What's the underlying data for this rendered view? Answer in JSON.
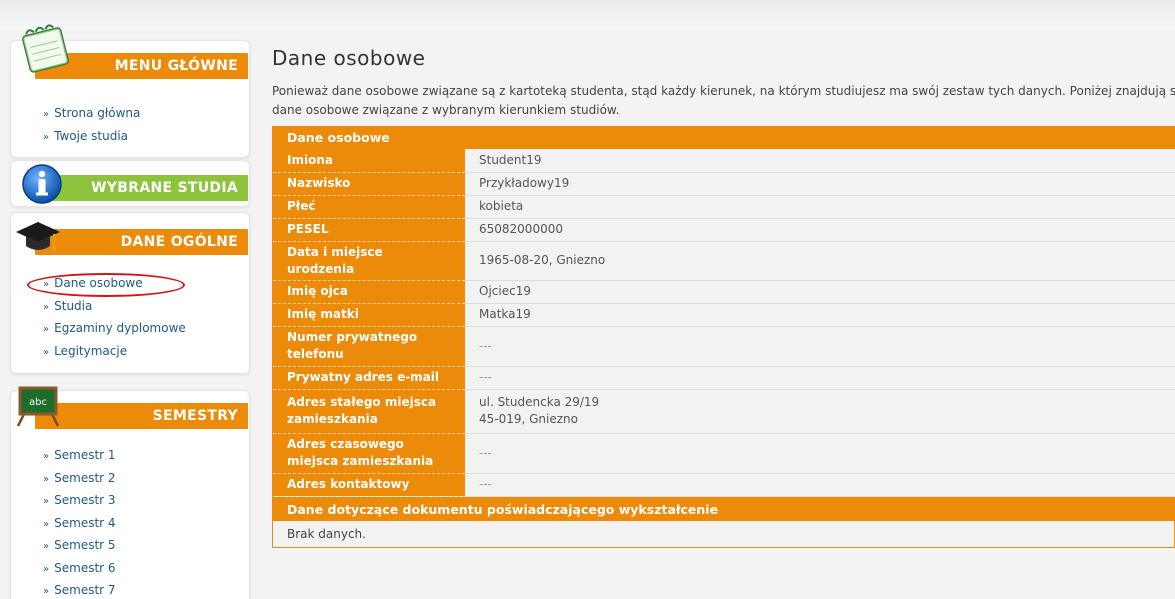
{
  "sidebar": {
    "menu": {
      "title": "MENU GŁÓWNE",
      "items": [
        "Strona główna",
        "Twoje studia"
      ]
    },
    "selected": {
      "title": "WYBRANE STUDIA"
    },
    "general": {
      "title": "DANE OGÓLNE",
      "items": [
        "Dane osobowe",
        "Studia",
        "Egzaminy dyplomowe",
        "Legitymacje"
      ]
    },
    "semesters": {
      "title": "SEMESTRY",
      "items": [
        "Semestr 1",
        "Semestr 2",
        "Semestr 3",
        "Semestr 4",
        "Semestr 5",
        "Semestr 6",
        "Semestr 7"
      ]
    },
    "arrow": "»",
    "blackboard_text": "abc"
  },
  "main": {
    "title": "Dane osobowe",
    "intro_line1": "Ponieważ dane osobowe związane są z kartoteką studenta, stąd każdy kierunek, na którym studiujesz ma swój zestaw tych danych. Poniżej znajdują się Tw",
    "intro_line2": "dane osobowe związane z wybranym kierunkiem studiów.",
    "personal": {
      "header": "Dane osobowe",
      "rows": [
        {
          "label": "Imiona",
          "value": "Student19"
        },
        {
          "label": "Nazwisko",
          "value": "Przykładowy19"
        },
        {
          "label": "Płeć",
          "value": "kobieta"
        },
        {
          "label": "PESEL",
          "value": "65082000000"
        },
        {
          "label": "Data i miejsce urodzenia",
          "value": "1965-08-20, Gniezno"
        },
        {
          "label": "Imię ojca",
          "value": "Ojciec19"
        },
        {
          "label": "Imię matki",
          "value": "Matka19"
        },
        {
          "label": "Numer prywatnego telefonu",
          "value": "---"
        },
        {
          "label": "Prywatny adres e-mail",
          "value": "---"
        },
        {
          "label": "Adres stałego miejsca zamieszkania",
          "value_line1": "ul. Studencka 29/19",
          "value_line2": "45-019, Gniezno"
        },
        {
          "label": "Adres czasowego miejsca zamieszkania",
          "value": "---"
        },
        {
          "label": "Adres kontaktowy",
          "value": "---"
        }
      ]
    },
    "education": {
      "header": "Dane dotyczące dokumentu poświadczającego wykształcenie",
      "body": "Brak danych."
    }
  },
  "colors": {
    "accent": "#ec8a0a",
    "green": "#8cc43c",
    "link": "#1f5a87",
    "highlight": "#d0161a"
  }
}
